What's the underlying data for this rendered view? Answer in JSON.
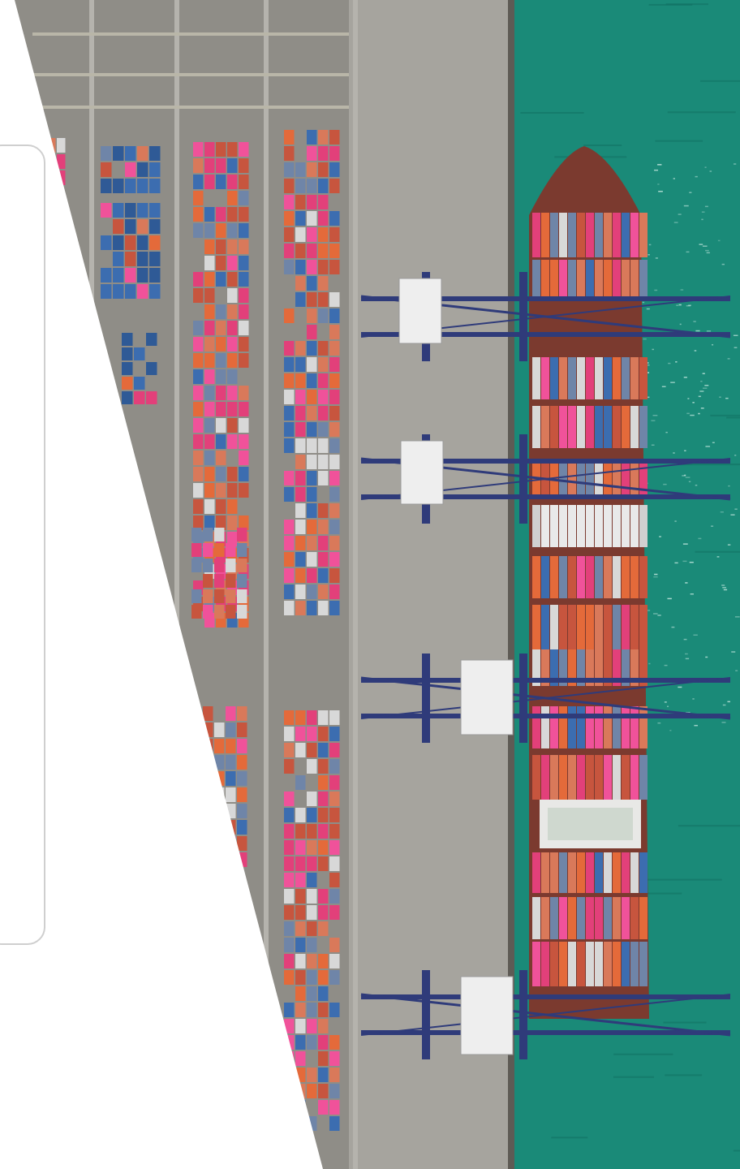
{
  "photo": {
    "subject": "aerial-container-port",
    "colors": {
      "sea": "#1a8a78",
      "sea_dark": "#0f6d5f",
      "yard": "#8f8d87",
      "quay": "#a6a49e",
      "crane_frame": "#2f3b7a",
      "crane_house": "#eeeeee",
      "container_palette": [
        "#c7553e",
        "#e2407a",
        "#3c6db0",
        "#d8d8d8",
        "#d9795a",
        "#f0529a",
        "#6f85a8",
        "#e46a3a"
      ]
    }
  },
  "panel": {
    "background": "#ffffff",
    "card_border": "#cfcfcf"
  }
}
